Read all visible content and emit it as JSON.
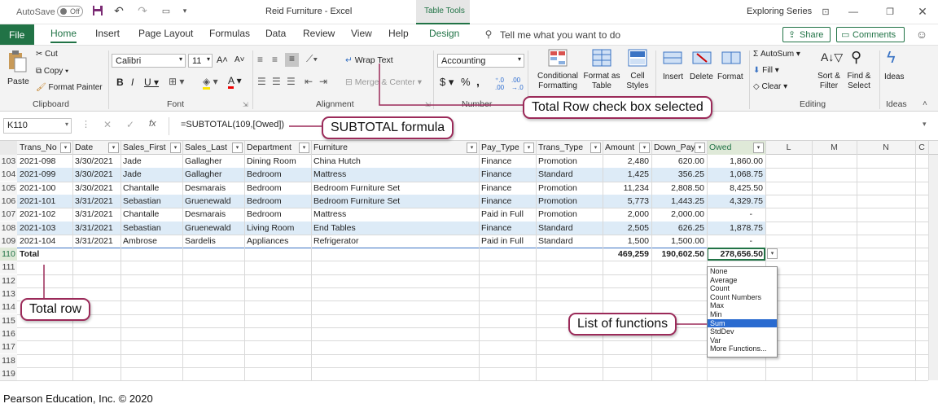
{
  "window": {
    "autosave_label": "AutoSave",
    "autosave_state": "Off",
    "title": "Reid Furniture - Excel",
    "context_tab": "Table Tools",
    "account": "Exploring Series"
  },
  "tabs": [
    "File",
    "Home",
    "Insert",
    "Page Layout",
    "Formulas",
    "Data",
    "Review",
    "View",
    "Help",
    "Design"
  ],
  "tell_me": "Tell me what you want to do",
  "share_label": "Share",
  "comments_label": "Comments",
  "ribbon": {
    "clipboard": {
      "paste": "Paste",
      "cut": "Cut",
      "copy": "Copy",
      "format_painter": "Format Painter",
      "group": "Clipboard"
    },
    "font": {
      "name": "Calibri",
      "size": "11",
      "group": "Font"
    },
    "alignment": {
      "wrap": "Wrap Text",
      "merge": "Merge & Center",
      "group": "Alignment"
    },
    "number": {
      "format": "Accounting",
      "group": "Number"
    },
    "styles": {
      "conditional": "Conditional Formatting",
      "format_table": "Format as Table",
      "cell_styles": "Cell Styles"
    },
    "cells": {
      "insert": "Insert",
      "delete": "Delete",
      "format": "Format"
    },
    "editing": {
      "autosum": "AutoSum",
      "fill": "Fill",
      "clear": "Clear",
      "sort": "Sort & Filter",
      "find": "Find & Select",
      "group": "Editing"
    },
    "ideas": {
      "label": "Ideas",
      "group": "Ideas"
    }
  },
  "formula_bar": {
    "name_box": "K110",
    "formula": "=SUBTOTAL(109,[Owed])"
  },
  "columns": [
    "Trans_No",
    "Date",
    "Sales_First",
    "Sales_Last",
    "Department",
    "Furniture",
    "Pay_Type",
    "Trans_Type",
    "Amount",
    "Down_Pay",
    "Owed",
    "L",
    "M",
    "N",
    "C"
  ],
  "rows": [
    {
      "num": "103",
      "cells": [
        "2021-098",
        "3/30/2021",
        "Jade",
        "Gallagher",
        "Dining Room",
        "China Hutch",
        "Finance",
        "Promotion",
        "2,480",
        "620.00",
        "1,860.00"
      ]
    },
    {
      "num": "104",
      "cells": [
        "2021-099",
        "3/30/2021",
        "Jade",
        "Gallagher",
        "Bedroom",
        "Mattress",
        "Finance",
        "Standard",
        "1,425",
        "356.25",
        "1,068.75"
      ]
    },
    {
      "num": "105",
      "cells": [
        "2021-100",
        "3/30/2021",
        "Chantalle",
        "Desmarais",
        "Bedroom",
        "Bedroom Furniture Set",
        "Finance",
        "Promotion",
        "11,234",
        "2,808.50",
        "8,425.50"
      ]
    },
    {
      "num": "106",
      "cells": [
        "2021-101",
        "3/31/2021",
        "Sebastian",
        "Gruenewald",
        "Bedroom",
        "Bedroom Furniture Set",
        "Finance",
        "Promotion",
        "5,773",
        "1,443.25",
        "4,329.75"
      ]
    },
    {
      "num": "107",
      "cells": [
        "2021-102",
        "3/31/2021",
        "Chantalle",
        "Desmarais",
        "Bedroom",
        "Mattress",
        "Paid in Full",
        "Promotion",
        "2,000",
        "2,000.00",
        "-"
      ]
    },
    {
      "num": "108",
      "cells": [
        "2021-103",
        "3/31/2021",
        "Sebastian",
        "Gruenewald",
        "Living Room",
        "End Tables",
        "Finance",
        "Standard",
        "2,505",
        "626.25",
        "1,878.75"
      ]
    },
    {
      "num": "109",
      "cells": [
        "2021-104",
        "3/31/2021",
        "Ambrose",
        "Sardelis",
        "Appliances",
        "Refrigerator",
        "Paid in Full",
        "Standard",
        "1,500",
        "1,500.00",
        "-"
      ]
    }
  ],
  "total_row": {
    "num": "110",
    "label": "Total",
    "amount": "469,259",
    "down_pay": "190,602.50",
    "owed": "278,656.50"
  },
  "empty_rows": [
    "111",
    "112",
    "113",
    "114",
    "115",
    "116",
    "117",
    "118",
    "119"
  ],
  "functions": [
    "None",
    "Average",
    "Count",
    "Count Numbers",
    "Max",
    "Min",
    "Sum",
    "StdDev",
    "Var",
    "More Functions..."
  ],
  "selected_function": "Sum",
  "callouts": {
    "total_row_checkbox": "Total Row check box selected",
    "subtotal": "SUBTOTAL formula",
    "total_row": "Total row",
    "functions": "List of functions"
  },
  "credit": "Pearson Education, Inc. © 2020",
  "colors": {
    "excel_green": "#217346",
    "callout_border": "#9b2a59",
    "banded_row": "#ddebf7",
    "selected_item": "#2a6bd0"
  }
}
